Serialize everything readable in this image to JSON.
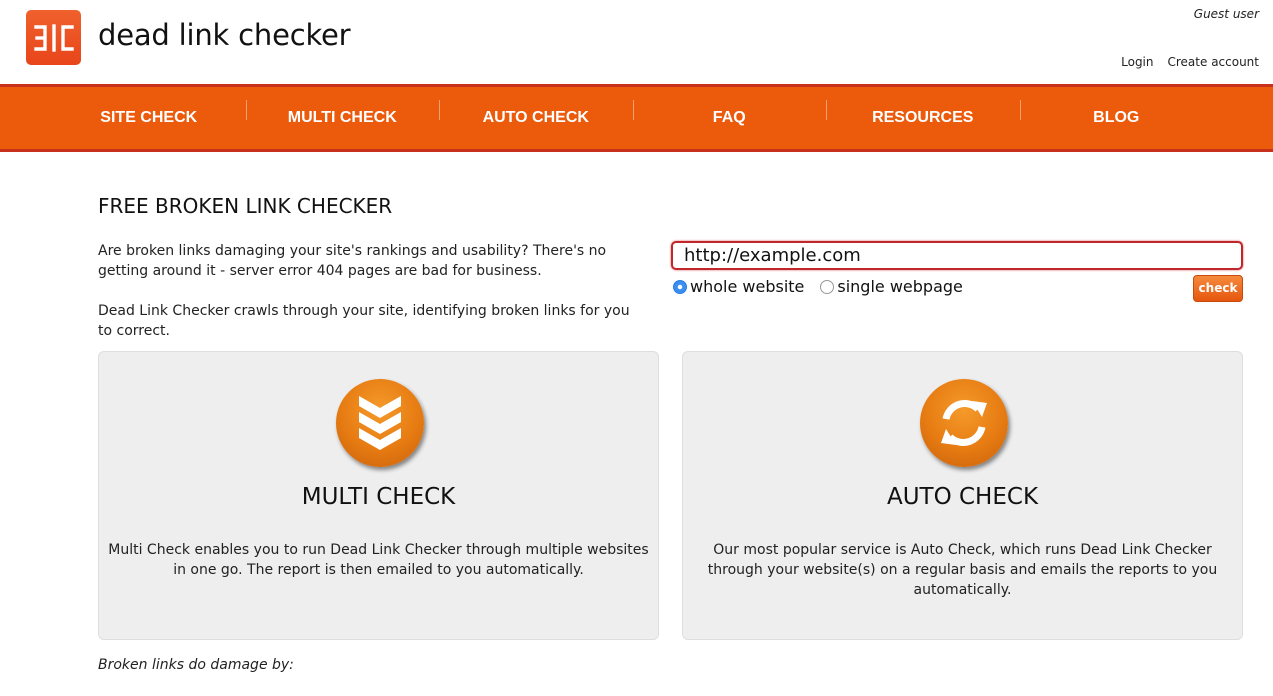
{
  "header": {
    "site_title": "dead link checker",
    "guest_user": "Guest user",
    "login": "Login",
    "create_account": "Create account"
  },
  "nav": {
    "items": [
      "SITE CHECK",
      "MULTI CHECK",
      "AUTO CHECK",
      "FAQ",
      "RESOURCES",
      "BLOG"
    ]
  },
  "main": {
    "heading": "FREE BROKEN LINK CHECKER",
    "intro_1": "Are broken links damaging your site's rankings and usability? There's no getting around it - server error 404 pages are bad for business.",
    "intro_2": "Dead Link Checker crawls through your site, identifying broken links for you to correct.",
    "url_value": "http://example.com",
    "radio_whole": "whole website",
    "radio_single": "single webpage",
    "selected_scope": "whole website",
    "check_button": "check"
  },
  "cards": {
    "multi": {
      "title": "MULTI CHECK",
      "text": "Multi Check enables you to run Dead Link Checker through multiple websites in one go. The report is then emailed to you automatically.",
      "icon": "chevrons-down-icon"
    },
    "auto": {
      "title": "AUTO CHECK",
      "text": "Our most popular service is Auto Check, which runs Dead Link Checker through your website(s) on a regular basis and emails the reports to you automatically.",
      "icon": "refresh-icon"
    }
  },
  "footer": {
    "damage_heading": "Broken links do damage by:"
  },
  "colors": {
    "brand_orange": "#ec5a0c",
    "nav_border": "#c8311b",
    "input_border": "#c0272d"
  }
}
